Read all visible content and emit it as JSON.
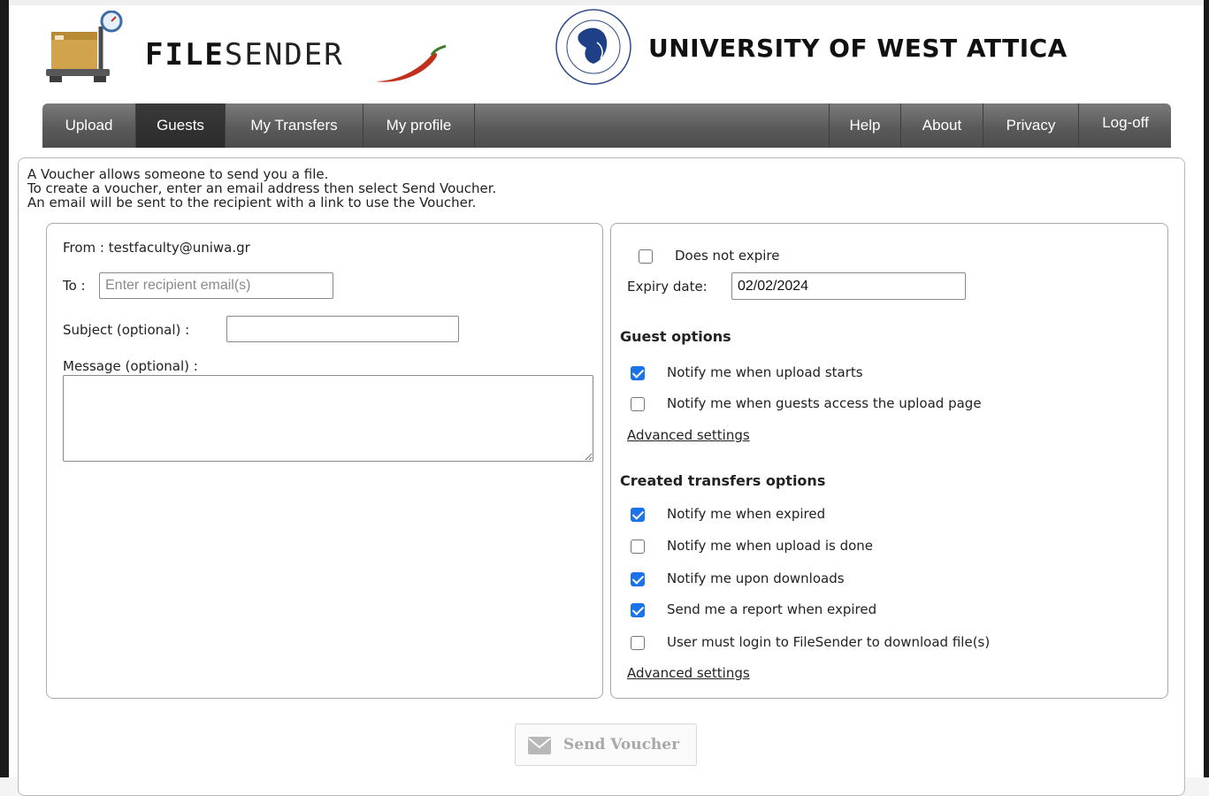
{
  "header": {
    "app_logo_text_bold": "FILE",
    "app_logo_text_light": "SENDER",
    "university_name": "UNIVERSITY OF WEST ATTICA"
  },
  "nav": {
    "left": [
      "Upload",
      "Guests",
      "My Transfers",
      "My profile"
    ],
    "right": [
      "Help",
      "About",
      "Privacy",
      "Log-off"
    ],
    "active": "Guests"
  },
  "intro": [
    "A Voucher allows someone to send you a file.",
    "To create a voucher, enter an email address then select Send Voucher.",
    "An email will be sent to the recipient with a link to use the Voucher."
  ],
  "form": {
    "from_label": "From : testfaculty@uniwa.gr",
    "to_label": "To :",
    "to_placeholder": "Enter recipient email(s)",
    "subject_label": "Subject (optional) :",
    "subject_value": "",
    "message_label": "Message (optional) :",
    "message_value": ""
  },
  "expiry": {
    "does_not_expire_label": "Does not expire",
    "does_not_expire_checked": false,
    "expiry_label": "Expiry date:",
    "expiry_value": "02/02/2024"
  },
  "guest_options": {
    "title": "Guest options",
    "items": [
      {
        "label": "Notify me when upload starts",
        "checked": true
      },
      {
        "label": "Notify me when guests access the upload page",
        "checked": false
      }
    ],
    "advanced": "Advanced settings"
  },
  "transfer_options": {
    "title": "Created transfers options",
    "items": [
      {
        "label": "Notify me when expired",
        "checked": true
      },
      {
        "label": "Notify me when upload is done",
        "checked": false
      },
      {
        "label": "Notify me upon downloads",
        "checked": true
      },
      {
        "label": "Send me a report when expired",
        "checked": true
      },
      {
        "label": "User must login to FileSender to download file(s)",
        "checked": false
      }
    ],
    "advanced": "Advanced settings"
  },
  "actions": {
    "send_voucher": "Send Voucher"
  },
  "colors": {
    "nav_bg": "#5a5a5a",
    "nav_active": "#2b2b2b",
    "checkbox_on": "#1a73e8",
    "chili": "#c0301c"
  }
}
